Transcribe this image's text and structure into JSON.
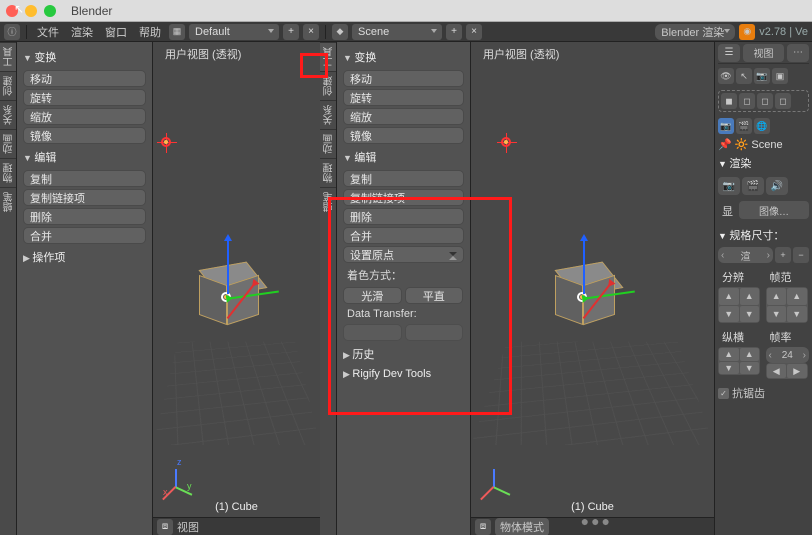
{
  "titlebar": {
    "title": "Blender"
  },
  "menubar": {
    "file": "文件",
    "render": "渲染",
    "window": "窗口",
    "help": "帮助",
    "layout": "Default",
    "scene": "Scene",
    "engine": "Blender 渲染",
    "version": "v2.78 | Ve"
  },
  "left_panel": {
    "transform": "变换",
    "move": "移动",
    "rotate": "旋转",
    "scale": "缩放",
    "mirror": "镜像",
    "edit": "编辑",
    "duplicate": "复制",
    "duplicate_linked": "复制链接项",
    "delete": "删除",
    "join": "合并",
    "operator": "操作项"
  },
  "tabs": {
    "tools": "工具",
    "create": "创建",
    "relations": "关系",
    "animation": "动画",
    "physics": "物理",
    "grease": "蜡笔"
  },
  "mid_panel": {
    "transform": "变换",
    "move": "移动",
    "rotate": "旋转",
    "scale": "缩放",
    "mirror": "镜像",
    "edit": "编辑",
    "duplicate": "复制",
    "duplicate_linked": "复制链接项",
    "delete": "删除",
    "join": "合并",
    "set_origin": "设置原点",
    "shading_label": "着色方式：",
    "smooth": "光滑",
    "flat": "平直",
    "data_transfer": "Data Transfer:",
    "history": "历史",
    "rigify": "Rigify Dev Tools"
  },
  "viewport": {
    "header": "用户视图  (透视)",
    "object": "(1) Cube",
    "mode": "视图",
    "objectmode": "物体模式"
  },
  "right": {
    "view_btn": "视图",
    "scene": "Scene",
    "render": "渲染",
    "dimensions": "规格尺寸：",
    "render_preset": "渲",
    "resolution": "分辨",
    "framerange": "帧范",
    "aspect": "纵横",
    "framerate": "帧率",
    "fps": "24",
    "aliasing": "抗锯齿",
    "disp": "显"
  }
}
